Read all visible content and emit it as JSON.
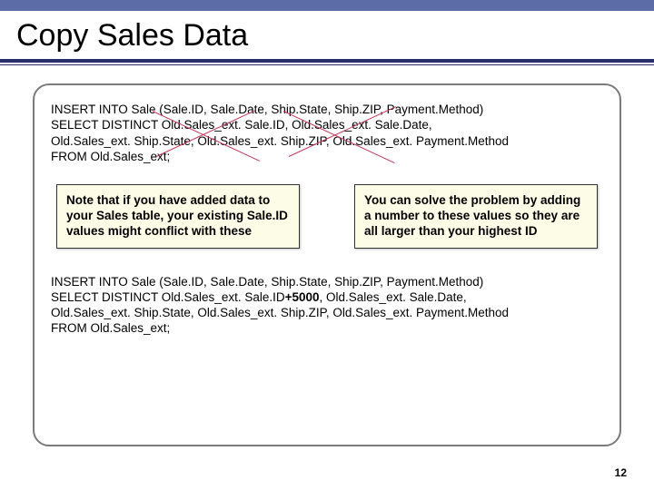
{
  "title": "Copy Sales Data",
  "sql_top": {
    "line1": "INSERT INTO Sale (Sale.ID, Sale.Date, Ship.State, Ship.ZIP, Payment.Method)",
    "line2": "SELECT DISTINCT Old.Sales_ext. Sale.ID, Old.Sales_ext. Sale.Date,",
    "line3": "Old.Sales_ext. Ship.State, Old.Sales_ext. Ship.ZIP, Old.Sales_ext. Payment.Method",
    "line4": "FROM Old.Sales_ext;"
  },
  "notes": {
    "left": "Note that if you have added data to your Sales table, your existing Sale.ID values might conflict with these",
    "right": "You can solve the problem by adding a number to these values so they are all larger than your highest ID"
  },
  "sql_bottom": {
    "line1": "INSERT INTO Sale (Sale.ID, Sale.Date, Ship.State, Ship.ZIP, Payment.Method)",
    "line2_pre": "SELECT DISTINCT Old.Sales_ext. Sale.ID",
    "line2_bold": "+5000",
    "line2_post": ", Old.Sales_ext. Sale.Date,",
    "line3": "Old.Sales_ext. Ship.State, Old.Sales_ext. Ship.ZIP, Old.Sales_ext. Payment.Method",
    "line4": "FROM Old.Sales_ext;"
  },
  "page_number": "12"
}
